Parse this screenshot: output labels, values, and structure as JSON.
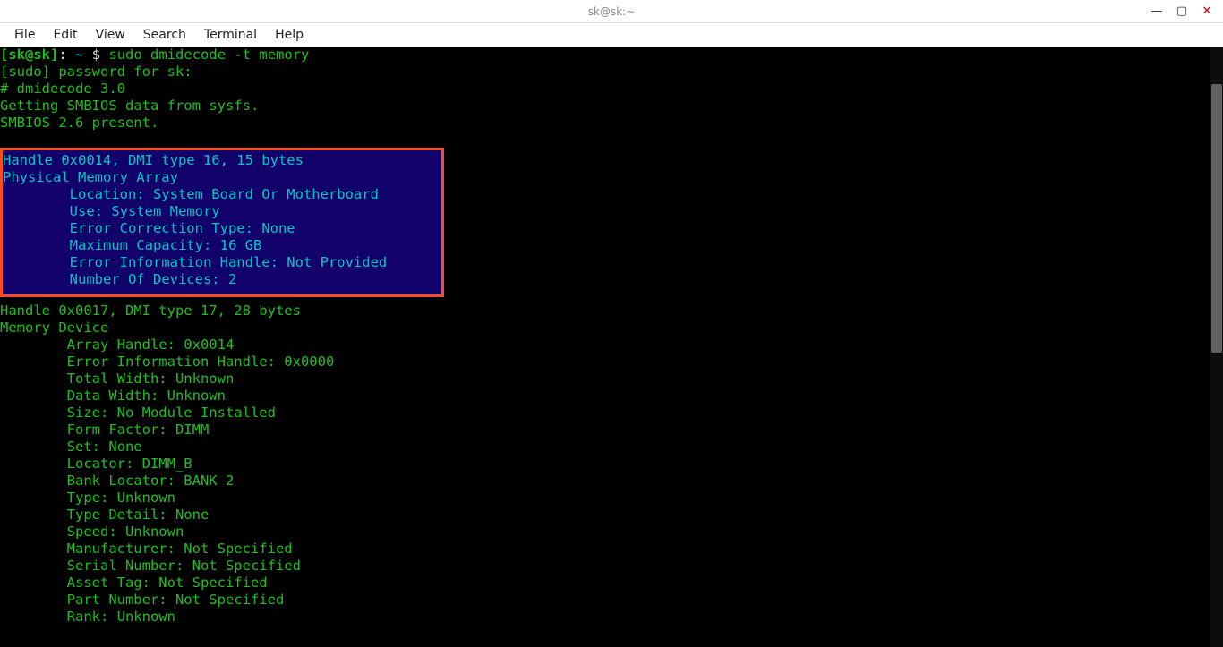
{
  "window": {
    "title": "sk@sk:~"
  },
  "menubar": {
    "items": [
      "File",
      "Edit",
      "View",
      "Search",
      "Terminal",
      "Help"
    ]
  },
  "prompt": {
    "user_host": "[sk@sk]",
    "sep": ": ",
    "path": "~",
    "dollar": "$",
    "command": "sudo dmidecode -t memory"
  },
  "output": {
    "sudo_line": "[sudo] password for sk:",
    "header1": "# dmidecode 3.0",
    "header2": "Getting SMBIOS data from sysfs.",
    "header3": "SMBIOS 2.6 present.",
    "block1_handle": "Handle 0x0014, DMI type 16, 15 bytes",
    "block1_title": "Physical Memory Array",
    "block1_fields": [
      "Location: System Board Or Motherboard",
      "Use: System Memory",
      "Error Correction Type: None",
      "Maximum Capacity: 16 GB",
      "Error Information Handle: Not Provided",
      "Number Of Devices: 2"
    ],
    "block2_handle": "Handle 0x0017, DMI type 17, 28 bytes",
    "block2_title": "Memory Device",
    "block2_fields": [
      "Array Handle: 0x0014",
      "Error Information Handle: 0x0000",
      "Total Width: Unknown",
      "Data Width: Unknown",
      "Size: No Module Installed",
      "Form Factor: DIMM",
      "Set: None",
      "Locator: DIMM_B",
      "Bank Locator: BANK 2",
      "Type: Unknown",
      "Type Detail: None",
      "Speed: Unknown",
      "Manufacturer: Not Specified",
      "Serial Number: Not Specified",
      "Asset Tag: Not Specified",
      "Part Number: Not Specified",
      "Rank: Unknown"
    ]
  }
}
